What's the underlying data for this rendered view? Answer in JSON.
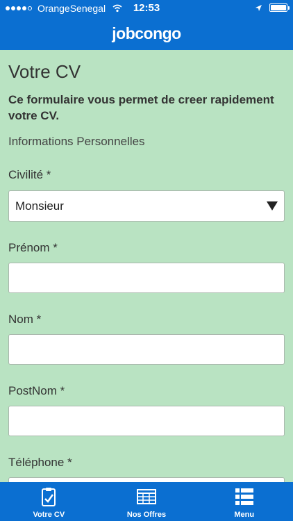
{
  "status_bar": {
    "carrier": "OrangeSenegal",
    "time": "12:53",
    "icons": [
      "signal-dots-icon",
      "wifi-icon",
      "location-arrow-icon",
      "battery-icon"
    ]
  },
  "header": {
    "title": "jobcongo"
  },
  "form": {
    "title": "Votre CV",
    "intro": "Ce formulaire vous permet de creer rapidement votre CV.",
    "section": "Informations Personnelles",
    "civility": {
      "label": "Civilité *",
      "value": "Monsieur"
    },
    "prenom": {
      "label": "Prénom *",
      "value": ""
    },
    "nom": {
      "label": "Nom *",
      "value": ""
    },
    "postnom": {
      "label": "PostNom *",
      "value": ""
    },
    "telephone": {
      "label": "Téléphone *",
      "value": ""
    }
  },
  "tabs": [
    {
      "label": "Votre CV",
      "icon": "clipboard-check-icon"
    },
    {
      "label": "Nos Offres",
      "icon": "newspaper-icon"
    },
    {
      "label": "Menu",
      "icon": "menu-list-icon"
    }
  ],
  "colors": {
    "brand_blue": "#0b6fd1",
    "background_green": "#b9e3c2"
  }
}
